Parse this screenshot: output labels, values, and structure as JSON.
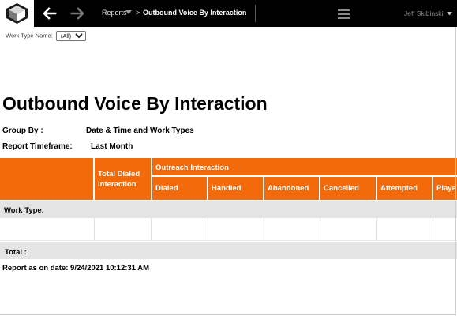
{
  "header": {
    "breadcrumb_root": "Reports",
    "breadcrumb_sep": ">",
    "breadcrumb_page": "Outbound Voice By Interaction",
    "user_name": "Jeff Skibinski"
  },
  "filter": {
    "label": "Work Type Name:",
    "selected": "(All)"
  },
  "report": {
    "title": "Outbound Voice By Interaction",
    "group_by_label": "Group By :",
    "group_by_value": "Date & Time and Work Types",
    "timeframe_label": "Report Timeframe:",
    "timeframe_value": "Last Month"
  },
  "table": {
    "total_dialed_line1": "Total Dialed",
    "total_dialed_line2": "Interaction",
    "group_header": "Outreach Interaction",
    "columns": [
      "Dialed",
      "Handled",
      "Abandoned",
      "Cancelled",
      "Attempted",
      "Playe"
    ],
    "work_type_label": "Work Type:",
    "total_label": "Total :"
  },
  "footer": {
    "report_date": "Report as on date: 9/24/2021 10:12:31 AM"
  },
  "colors": {
    "topbar": "#000000",
    "accent_orange": "#f36a0a",
    "band_gray": "#e4e4e4"
  }
}
